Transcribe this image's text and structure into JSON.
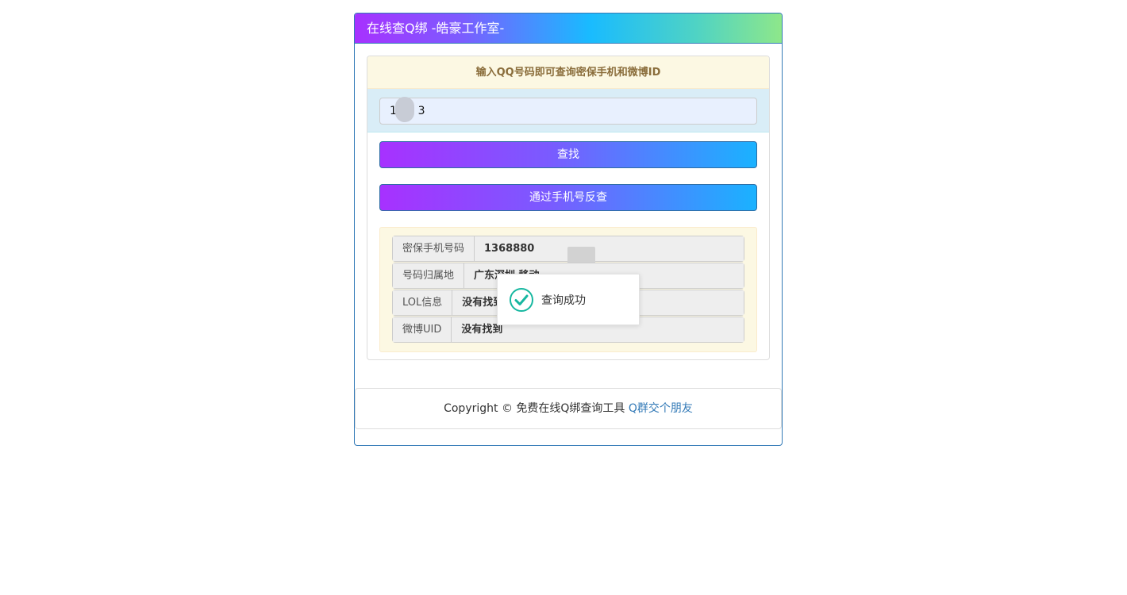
{
  "header": {
    "title": "在线查Q绑 -皓豪工作室-"
  },
  "form": {
    "heading": "输入QQ号码即可查询密保手机和微博ID",
    "qq_value": "1      3",
    "search_button": "查找",
    "reverse_button": "通过手机号反查"
  },
  "results": [
    {
      "label": "密保手机号码",
      "value": "1368880"
    },
    {
      "label": "号码归属地",
      "value": "广东深圳 移动"
    },
    {
      "label": "LOL信息",
      "value": "没有找到"
    },
    {
      "label": "微博UID",
      "value": "没有找到"
    }
  ],
  "footer": {
    "copyright": "Copyright © 免费在线Q绑查询工具 ",
    "link": "Q群交个朋友"
  },
  "toast": {
    "icon": "check-circle-icon",
    "message": "查询成功"
  },
  "colors": {
    "accent_purple": "#a731ff",
    "accent_blue": "#1ab2ff",
    "success_green": "#16b7a0"
  }
}
